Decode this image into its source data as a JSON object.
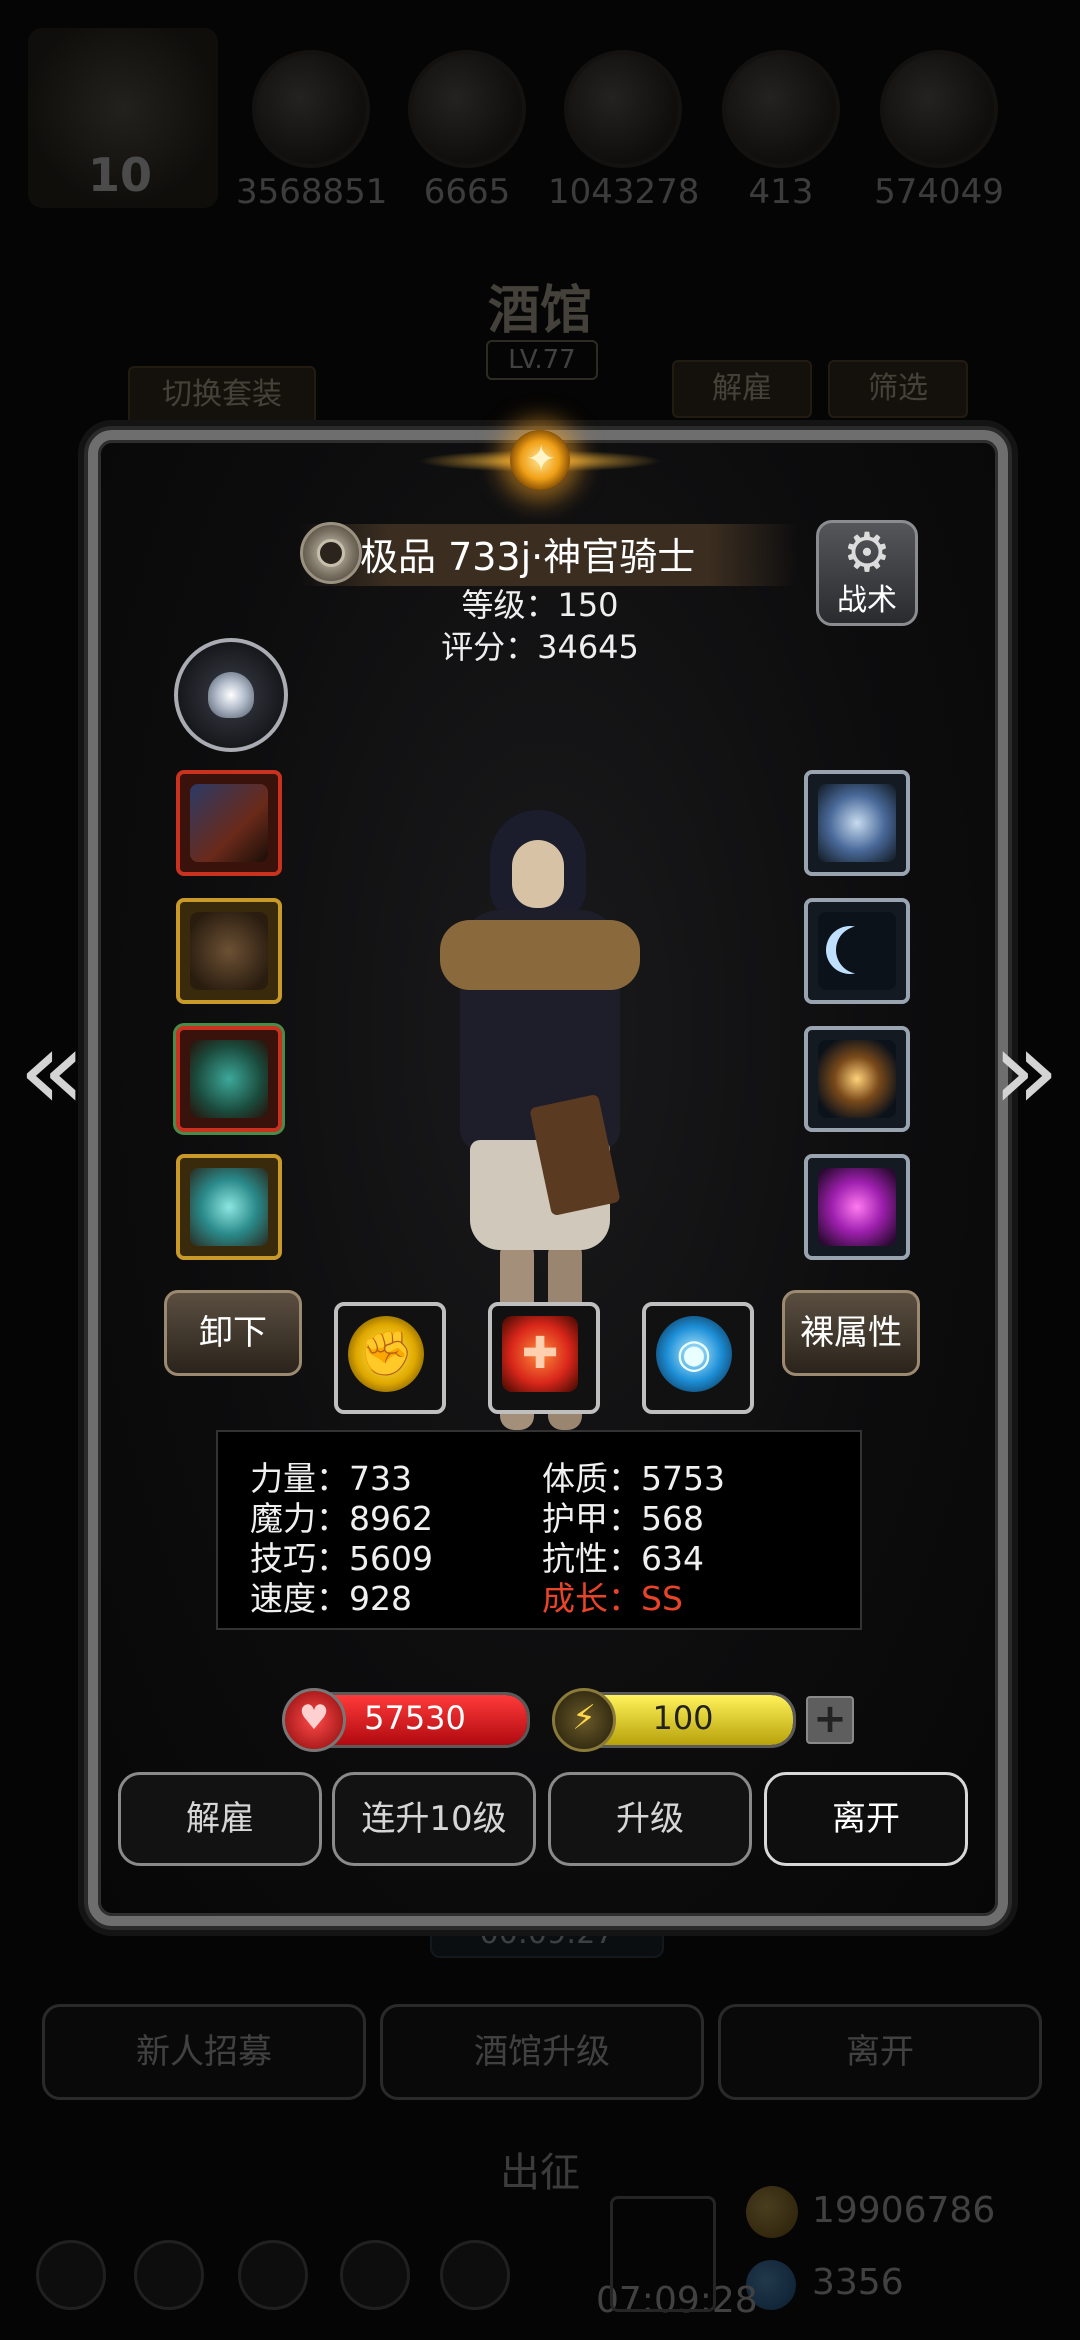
{
  "top_resources": {
    "player_level": "10",
    "values": [
      "3568851",
      "6665",
      "1043278",
      "413",
      "574049"
    ]
  },
  "tavern": {
    "title": "酒馆",
    "level": "LV.77",
    "switch_set_label": "切换套装",
    "dismiss_label": "解雇",
    "filter_label": "筛选",
    "timer": "00:09:27",
    "buttons": [
      "新人招募",
      "酒馆升级",
      "离开"
    ],
    "sortie_label": "出征",
    "gold": "19906786",
    "gems": "3356",
    "bottom_timer": "07:09:28"
  },
  "hero": {
    "name": "极品 733j·神官骑士",
    "level_text": "等级：150",
    "score_text": "评分：34645",
    "tactics_label": "战术",
    "unequip_label": "卸下",
    "raw_stats_label": "裸属性"
  },
  "stats": {
    "left": [
      "力量：733",
      "魔力：8962",
      "技巧：5609",
      "速度：928"
    ],
    "right": [
      "体质：5753",
      "护甲：568",
      "抗性：634"
    ],
    "growth": "成长：SS"
  },
  "bars": {
    "hp": "57530",
    "energy": "100",
    "hp_fill": 1.0,
    "energy_fill": 1.0
  },
  "actions": [
    "解雇",
    "连升10级",
    "升级",
    "离开"
  ],
  "icons": {
    "nav_left": "chevron-left-icon",
    "nav_right": "chevron-right-icon",
    "skills": [
      "fist-icon",
      "heal-cross-icon",
      "eye-icon"
    ]
  },
  "colors": {
    "hp": "#d8121a",
    "energy": "#d6c81e",
    "growth": "#e8442a"
  }
}
